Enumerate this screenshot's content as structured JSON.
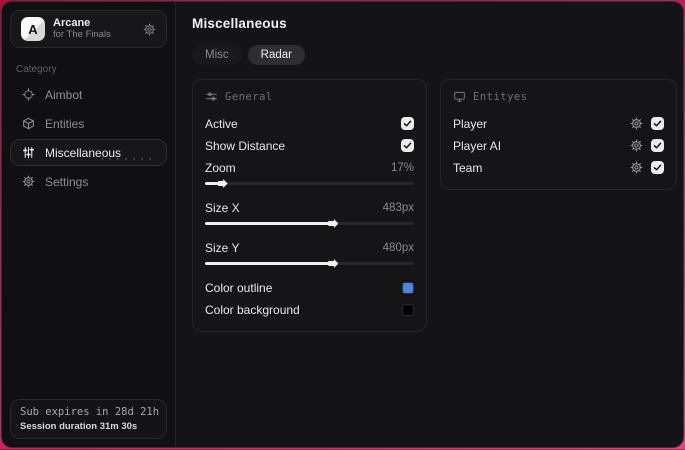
{
  "app": {
    "name": "Arcane",
    "subtitle": "for The Finals",
    "logo_letter": "A"
  },
  "sidebar": {
    "category_label": "Category",
    "items": [
      {
        "label": "Aimbot",
        "icon": "crosshair-icon",
        "active": false
      },
      {
        "label": "Entities",
        "icon": "cube-icon",
        "active": false
      },
      {
        "label": "Miscellaneous",
        "icon": "sliders-icon",
        "active": true
      },
      {
        "label": "Settings",
        "icon": "gear-icon",
        "active": false
      }
    ],
    "subscription": {
      "line1": "Sub expires in 28d 21h",
      "line2": "Session duration 31m 30s"
    }
  },
  "main": {
    "title": "Miscellaneous",
    "tabs": [
      {
        "label": "Misc",
        "active": false
      },
      {
        "label": "Radar",
        "active": true
      }
    ],
    "general_panel": {
      "header": "General",
      "header_icon": "sliders-horizontal-icon",
      "rows": [
        {
          "type": "checkbox",
          "label": "Active",
          "checked": true
        },
        {
          "type": "checkbox",
          "label": "Show Distance",
          "checked": true
        },
        {
          "type": "slider",
          "label": "Zoom",
          "value": "17%",
          "percent": 7
        },
        {
          "type": "slider",
          "label": "Size X",
          "value": "483px",
          "percent": 60
        },
        {
          "type": "slider",
          "label": "Size Y",
          "value": "480px",
          "percent": 60
        },
        {
          "type": "color",
          "label": "Color outline",
          "color": "#4b87e8"
        },
        {
          "type": "color",
          "label": "Color background",
          "color": "#000000"
        }
      ]
    },
    "entities_panel": {
      "header": "Entityes",
      "header_icon": "monitor-icon",
      "rows": [
        {
          "label": "Player",
          "icon": "gear-icon",
          "checked": true
        },
        {
          "label": "Player AI",
          "icon": "gear-icon",
          "checked": true
        },
        {
          "label": "Team",
          "icon": "gear-icon",
          "checked": true
        }
      ]
    }
  },
  "colors": {
    "accent_outline": "#4b87e8",
    "swatch_background": "#000000",
    "desktop_top": "#a90f38",
    "desktop_bottom": "#e2447f"
  }
}
